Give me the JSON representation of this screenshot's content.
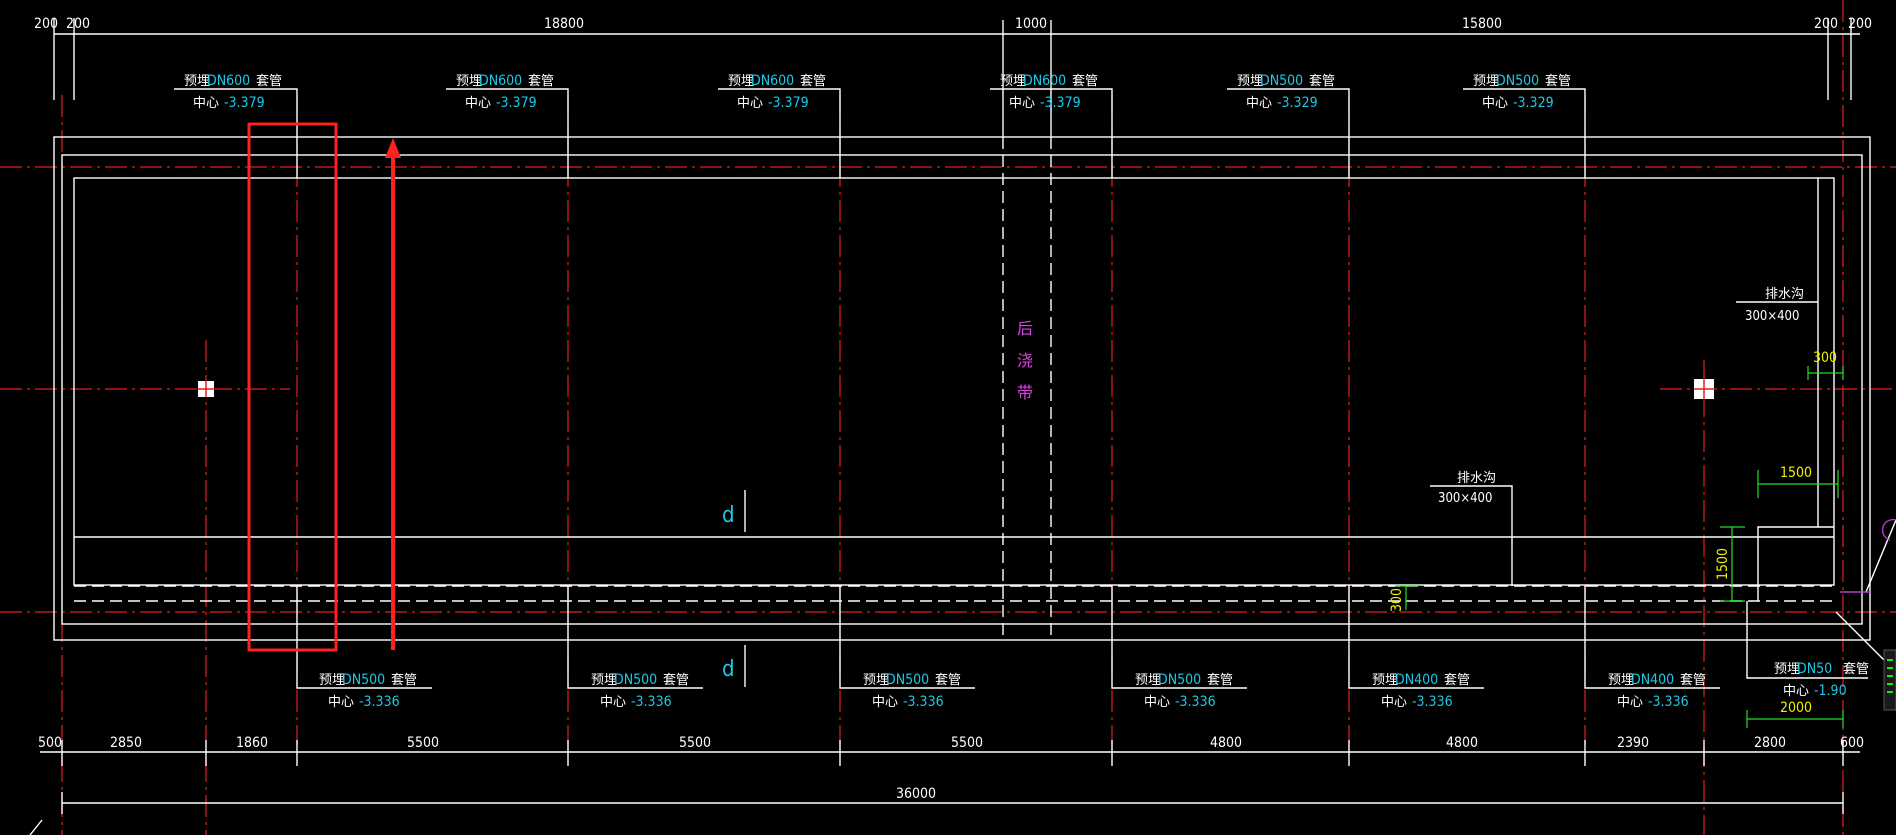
{
  "top_dims": {
    "a": "200",
    "b": "200",
    "c": "18800",
    "d": "1000",
    "e": "15800",
    "f": "200",
    "g": "200"
  },
  "bottom_dims": {
    "s1": "500",
    "s2": "2850",
    "s3": "1860",
    "s4": "5500",
    "s5": "5500",
    "s6": "5500",
    "s7": "4800",
    "s8": "4800",
    "s9": "2390",
    "s10": "2800",
    "s11": "600",
    "total": "36000"
  },
  "pipes_top": [
    {
      "type": "预埋",
      "dn": "DN600",
      "suffix": "套管",
      "center_label": "中心",
      "elev": "-3.379"
    },
    {
      "type": "预埋",
      "dn": "DN600",
      "suffix": "套管",
      "center_label": "中心",
      "elev": "-3.379"
    },
    {
      "type": "预埋",
      "dn": "DN600",
      "suffix": "套管",
      "center_label": "中心",
      "elev": "-3.379"
    },
    {
      "type": "预埋",
      "dn": "DN600",
      "suffix": "套管",
      "center_label": "中心",
      "elev": "-3.379"
    },
    {
      "type": "预埋",
      "dn": "DN500",
      "suffix": "套管",
      "center_label": "中心",
      "elev": "-3.329"
    },
    {
      "type": "预埋",
      "dn": "DN500",
      "suffix": "套管",
      "center_label": "中心",
      "elev": "-3.329"
    }
  ],
  "pipes_bottom": [
    {
      "type": "预埋",
      "dn": "DN500",
      "suffix": "套管",
      "center_label": "中心",
      "elev": "-3.336"
    },
    {
      "type": "预埋",
      "dn": "DN500",
      "suffix": "套管",
      "center_label": "中心",
      "elev": "-3.336"
    },
    {
      "type": "预埋",
      "dn": "DN500",
      "suffix": "套管",
      "center_label": "中心",
      "elev": "-3.336"
    },
    {
      "type": "预埋",
      "dn": "DN500",
      "suffix": "套管",
      "center_label": "中心",
      "elev": "-3.336"
    },
    {
      "type": "预埋",
      "dn": "DN400",
      "suffix": "套管",
      "center_label": "中心",
      "elev": "-3.336"
    },
    {
      "type": "预埋",
      "dn": "DN400",
      "suffix": "套管",
      "center_label": "中心",
      "elev": "-3.336"
    },
    {
      "type": "预埋",
      "dn": "DN50",
      "suffix": "套管",
      "center_label": "中心",
      "elev": "-1.90"
    }
  ],
  "post_pour": {
    "c1": "后",
    "c2": "浇",
    "c3": "带"
  },
  "drain_right": {
    "name": "排水沟",
    "size": "300×400"
  },
  "drain_mid": {
    "name": "排水沟",
    "size": "300×400"
  },
  "green_dims": {
    "d300_top": "300",
    "d1500_h": "1500",
    "d1500_v": "1500",
    "d300_bot": "300",
    "d2000": "2000"
  },
  "section_marks": {
    "upper": "d",
    "lower": "d"
  },
  "colors": {
    "background": "#000000",
    "lines": "#ffffff",
    "axis": "#e02020",
    "text_cyan": "#1ec8e6",
    "text_yellow": "#f0f000",
    "text_magenta": "#e040e0",
    "dim_green": "#20e020",
    "highlight": "#ff2020"
  }
}
